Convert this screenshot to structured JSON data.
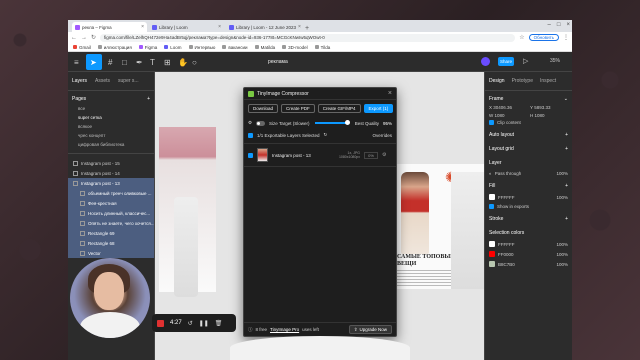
{
  "browser": {
    "tabs": [
      {
        "label": "рекла – Figma"
      },
      {
        "label": "Library | Loom"
      },
      {
        "label": "Library | Loom - 12 June 2023"
      }
    ],
    "url": "figma.com/file/LZelhQH472e9Ha4adBr5qj/реклама?type=design&node-id=936-1778t=MCGcKNwIw5qWOwt-0",
    "update_label": "Обновить",
    "bookmarks": [
      "Gmail",
      "иллюстрация",
      "Figma",
      "Loom",
      "Интервью",
      "вакансии",
      "Matilda",
      "3D-model",
      "Tilda"
    ]
  },
  "figma": {
    "file_title": "реклама",
    "share_label": "Share",
    "zoom": "35%",
    "left_tabs": [
      "Layers",
      "Assets",
      "super s..."
    ],
    "pages_label": "Pages",
    "pages": [
      "все",
      "super сетка",
      "всякое",
      "чрес концепт",
      "цифровая библиотека"
    ],
    "layers": [
      {
        "label": "Instagram post - 15",
        "indent": false,
        "hl": false
      },
      {
        "label": "Instagram post - 14",
        "indent": false,
        "hl": false
      },
      {
        "label": "Instagram post - 13",
        "indent": false,
        "hl": true
      },
      {
        "label": "объемный тренч оливковые ...",
        "indent": true,
        "hl": true
      },
      {
        "label": "Фея-крестная",
        "indent": true,
        "hl": true
      },
      {
        "label": "Носить длинный, классичес...",
        "indent": true,
        "hl": true
      },
      {
        "label": "Опять не знаете, чего хочется...",
        "indent": true,
        "hl": true
      },
      {
        "label": "Rectangle 69",
        "indent": true,
        "hl": true
      },
      {
        "label": "Rectangle 68",
        "indent": true,
        "hl": true
      },
      {
        "label": "Vector",
        "indent": true,
        "hl": true
      }
    ],
    "right_tabs": [
      "Design",
      "Prototype",
      "Inspect"
    ],
    "frame": {
      "label": "Frame",
      "x": "30406.36",
      "y": "5893.33",
      "w": "1080",
      "h": "1080"
    },
    "clip_content": "Clip content",
    "auto_layout": "Auto layout",
    "layout_grid": "Layout grid",
    "layer_label": "Layer",
    "pass_through": "Pass through",
    "layer_opacity": "100%",
    "fill_label": "Fill",
    "fill": {
      "hex": "FFFFFF",
      "opacity": "100%"
    },
    "show_exports": "Show in exports",
    "stroke_label": "Stroke",
    "selection_colors_label": "Selection colors",
    "selection_colors": [
      {
        "hex": "FFFFFF",
        "color": "#FFFFFF",
        "opacity": "100%"
      },
      {
        "hex": "FF0000",
        "color": "#FF0000",
        "opacity": "100%"
      },
      {
        "hex": "B8C7B0",
        "color": "#B8C7B0",
        "opacity": "100%"
      }
    ]
  },
  "canvas": {
    "headline": "САМЫЕ ТОПОВЫЕ ВЕЩИ"
  },
  "plugin": {
    "title": "TinyImage Compressor",
    "buttons": {
      "download": "Download",
      "pdf": "Create PDF",
      "gif": "Create GIF/MP4",
      "export": "Export (1)"
    },
    "size_target": "Size Target (Slower)",
    "best_quality": "Best Quality",
    "quality_value": "95%",
    "quality_fraction": 0.95,
    "selected_label": "1/1 Exportable Layers Selected",
    "overrides": "Overrides",
    "item": {
      "name": "Instagram post - 13",
      "format": "1x, JPG",
      "size": "1080x1080px",
      "pct": "0%"
    },
    "footer_text": "8 free",
    "footer_link": "TinyImage Pro",
    "footer_tail": "uses left",
    "upgrade_label": "Upgrade Now"
  },
  "recorder": {
    "time": "4:27"
  }
}
